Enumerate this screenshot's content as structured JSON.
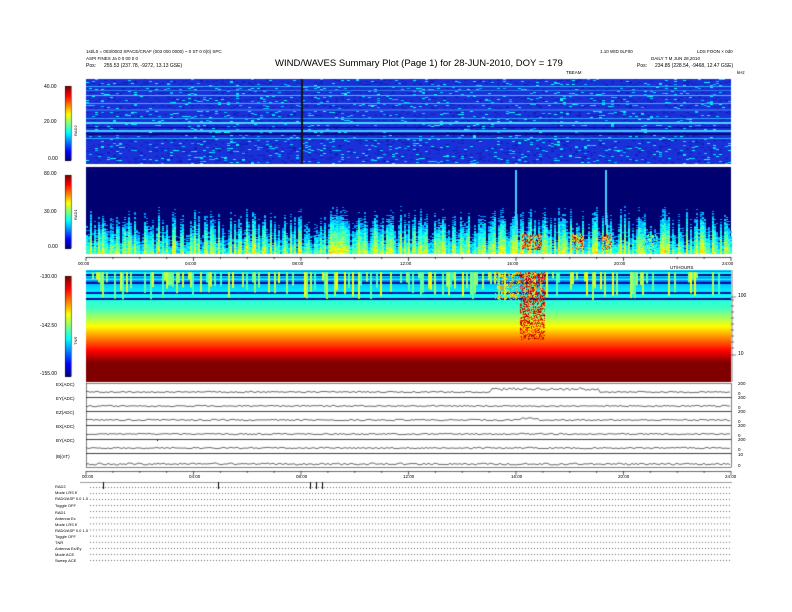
{
  "header": {
    "left_line1": "1st/L0 = 003/0003 SPACE/CRAF (003 000 0000) ~ 0 ST 0 0(0) SPC",
    "left_line2": "ASPI FINES Ja 0 0 00 0 0",
    "left_pos_label": "Pos:",
    "left_pos_value": "255.53 (237.78, -9272, 13.13 GSE)",
    "title": "WIND/WAVES Summary Plot (Page 1) for 28-JUN-2010, DOY = 179",
    "right_line1_a": "1.10 WID 0LF00",
    "right_line1_b": "LDS FOON × 0d0",
    "right_line2": "DAILY T M JUN 28,2010",
    "right_pos_label": "Pos:",
    "right_pos_value": "234.85 (228.54, -9468, 12.47 GSE)",
    "right_small": "TBEAM",
    "right_unit": "kHz"
  },
  "time_axis": {
    "ticks": [
      "00:00",
      "04:00",
      "08:00",
      "12:00",
      "16:00",
      "20:00",
      "24:00"
    ],
    "label": "UT/HOURS"
  },
  "panels": {
    "rad2": {
      "name": "RAD2",
      "scale": [
        "40.00",
        "20.00",
        "0.00"
      ]
    },
    "rad1": {
      "name": "RAD1",
      "scale": [
        "80.00",
        "30.00",
        "0.00"
      ]
    },
    "tnr": {
      "name": "TNR",
      "scale": [
        "-130.00",
        "-142.50",
        "-155.00"
      ],
      "right_ticks": [
        "100",
        "10"
      ]
    }
  },
  "line_panels": [
    {
      "label": "EX(ADC)",
      "right": [
        "200",
        "0"
      ]
    },
    {
      "label": "EY(ADC)",
      "right": [
        "200",
        "0"
      ]
    },
    {
      "label": "EZ(ADC)",
      "right": [
        "200",
        "0"
      ]
    },
    {
      "label": "BX(ADC)",
      "right": [
        "200",
        "0"
      ]
    },
    {
      "label": "BY(ADC)",
      "right": [
        "200",
        "0"
      ]
    },
    {
      "label": "|B|(nT)",
      "right": [
        "10",
        "0"
      ]
    }
  ],
  "status": {
    "rows": [
      "RAD2",
      "Mode  LRS fl",
      "RAD0/ASP 0.0 1.0",
      "Toggle  OFF",
      "RAD1",
      "Antenna  Ex",
      "Mode  LRS fl",
      "RAD0/ASP 0.0 1.0",
      "Toggle  OFF",
      "TNR",
      "Antenna  Ex/Ey",
      "Mode  ACE",
      "Sweep  ACE"
    ]
  },
  "colors": {
    "bg_blue": "#1a2fd8",
    "dark_blue": "#00008c",
    "cyan": "#00dfff",
    "green": "#22ff44",
    "yellow": "#ffff00",
    "red": "#ff0000"
  }
}
